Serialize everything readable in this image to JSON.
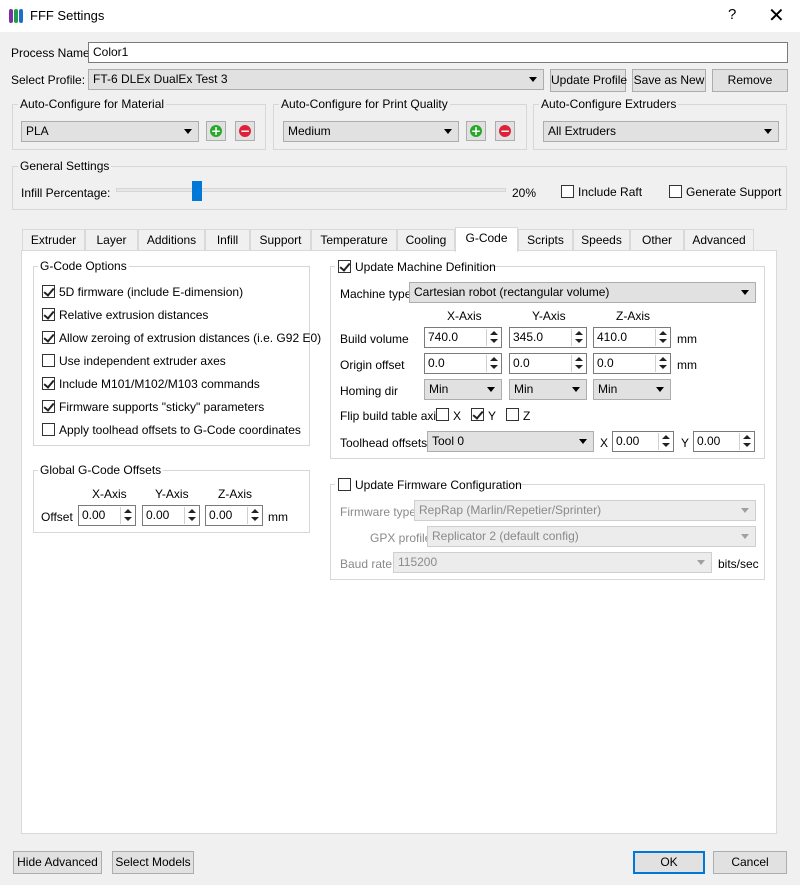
{
  "window": {
    "title": "FFF Settings",
    "help_label": "?",
    "close_label": "✕"
  },
  "process": {
    "label": "Process Name:",
    "value": "Color1"
  },
  "profile": {
    "label": "Select Profile:",
    "value": "FT-6 DLEx DualEx Test 3",
    "update_label": "Update Profile",
    "save_new_label": "Save as New",
    "remove_label": "Remove"
  },
  "auto_material": {
    "title": "Auto-Configure for Material",
    "value": "PLA"
  },
  "auto_quality": {
    "title": "Auto-Configure for Print Quality",
    "value": "Medium"
  },
  "auto_extruders": {
    "title": "Auto-Configure Extruders",
    "value": "All Extruders"
  },
  "general": {
    "title": "General Settings",
    "infill_label": "Infill Percentage:",
    "infill_value": "20%",
    "infill_fraction": 0.2,
    "raft_label": "Include Raft",
    "raft_checked": false,
    "support_label": "Generate Support",
    "support_checked": false
  },
  "tabs": [
    "Extruder",
    "Layer",
    "Additions",
    "Infill",
    "Support",
    "Temperature",
    "Cooling",
    "G-Code",
    "Scripts",
    "Speeds",
    "Other",
    "Advanced"
  ],
  "active_tab": "G-Code",
  "gcode_options": {
    "title": "G-Code Options",
    "items": [
      {
        "label": "5D firmware (include E-dimension)",
        "checked": true
      },
      {
        "label": "Relative extrusion distances",
        "checked": true
      },
      {
        "label": "Allow zeroing of extrusion distances (i.e. G92 E0)",
        "checked": true
      },
      {
        "label": "Use independent extruder axes",
        "checked": false
      },
      {
        "label": "Include M101/M102/M103 commands",
        "checked": true
      },
      {
        "label": "Firmware supports \"sticky\" parameters",
        "checked": true
      },
      {
        "label": "Apply toolhead offsets to G-Code coordinates",
        "checked": false
      }
    ]
  },
  "global_offsets": {
    "title": "Global G-Code Offsets",
    "x_header": "X-Axis",
    "y_header": "Y-Axis",
    "z_header": "Z-Axis",
    "row_label": "Offset",
    "x": "0.00",
    "y": "0.00",
    "z": "0.00",
    "unit": "mm"
  },
  "machine": {
    "update_label": "Update Machine Definition",
    "update_checked": true,
    "type_label": "Machine type",
    "type_value": "Cartesian robot (rectangular volume)",
    "x_header": "X-Axis",
    "y_header": "Y-Axis",
    "z_header": "Z-Axis",
    "build_label": "Build volume",
    "build_x": "740.0",
    "build_y": "345.0",
    "build_z": "410.0",
    "build_unit": "mm",
    "origin_label": "Origin offset",
    "origin_x": "0.0",
    "origin_y": "0.0",
    "origin_z": "0.0",
    "origin_unit": "mm",
    "homing_label": "Homing dir",
    "homing_x": "Min",
    "homing_y": "Min",
    "homing_z": "Min",
    "flip_label": "Flip build table axis",
    "flip_x_label": "X",
    "flip_x": false,
    "flip_y_label": "Y",
    "flip_y": true,
    "flip_z_label": "Z",
    "flip_z": false,
    "toolhead_label": "Toolhead offsets",
    "toolhead_value": "Tool 0",
    "th_x_label": "X",
    "th_x": "0.00",
    "th_y_label": "Y",
    "th_y": "0.00"
  },
  "firmware": {
    "update_label": "Update Firmware Configuration",
    "update_checked": false,
    "type_label": "Firmware type",
    "type_value": "RepRap (Marlin/Repetier/Sprinter)",
    "gpx_label": "GPX profile",
    "gpx_value": "Replicator 2 (default config)",
    "baud_label": "Baud rate",
    "baud_value": "115200",
    "baud_unit": "bits/sec"
  },
  "footer": {
    "hide_advanced_label": "Hide Advanced",
    "select_models_label": "Select Models",
    "ok_label": "OK",
    "cancel_label": "Cancel"
  }
}
